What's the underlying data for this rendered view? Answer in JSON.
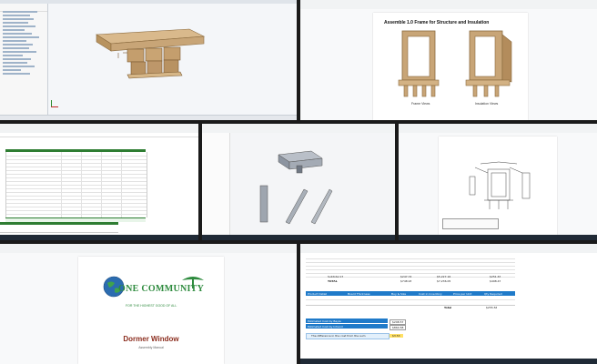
{
  "doc_assembly": {
    "title": "Assemble 1.0 Frame for Structure and Insulation",
    "caption_left": "Frame Views",
    "caption_right": "Insulation Views"
  },
  "doc_cover": {
    "logo_text": "ONE COMMUNITY",
    "tagline": "FOR THE HIGHEST GOOD OF ALL",
    "title": "Dormer Window",
    "subtitle": "Assembly Manual"
  },
  "sheet_bottom": {
    "rows": [
      {
        "label": "Subtotal 17",
        "v1": "$247.74",
        "v2": "$5,227.16",
        "v3": "$251.67"
      },
      {
        "label": "TOTAL",
        "v1": "$748.93",
        "v2": "$7,236.05",
        "v3": "$498.47"
      }
    ],
    "headers": [
      "Product Detail",
      "Board Thickness",
      "Buy & Size",
      "Cost in Inventory",
      "Price per Unit",
      "Qty Required"
    ],
    "total_label": "Total",
    "total_value": "$255.56",
    "est_rows": [
      {
        "label": "Estimated Cost by Bayle",
        "value": "$298.57"
      },
      {
        "label": "Estimated Cost by Inhand",
        "value": "$864.58"
      }
    ],
    "note": "The difference in the cost from the sum",
    "note_value": "$3.53"
  },
  "colors": {
    "wood": "#c8a577",
    "sheet_green": "#2e7d32",
    "sheet_blue": "#1f7ac9",
    "logo_green": "#2e8b3e"
  }
}
